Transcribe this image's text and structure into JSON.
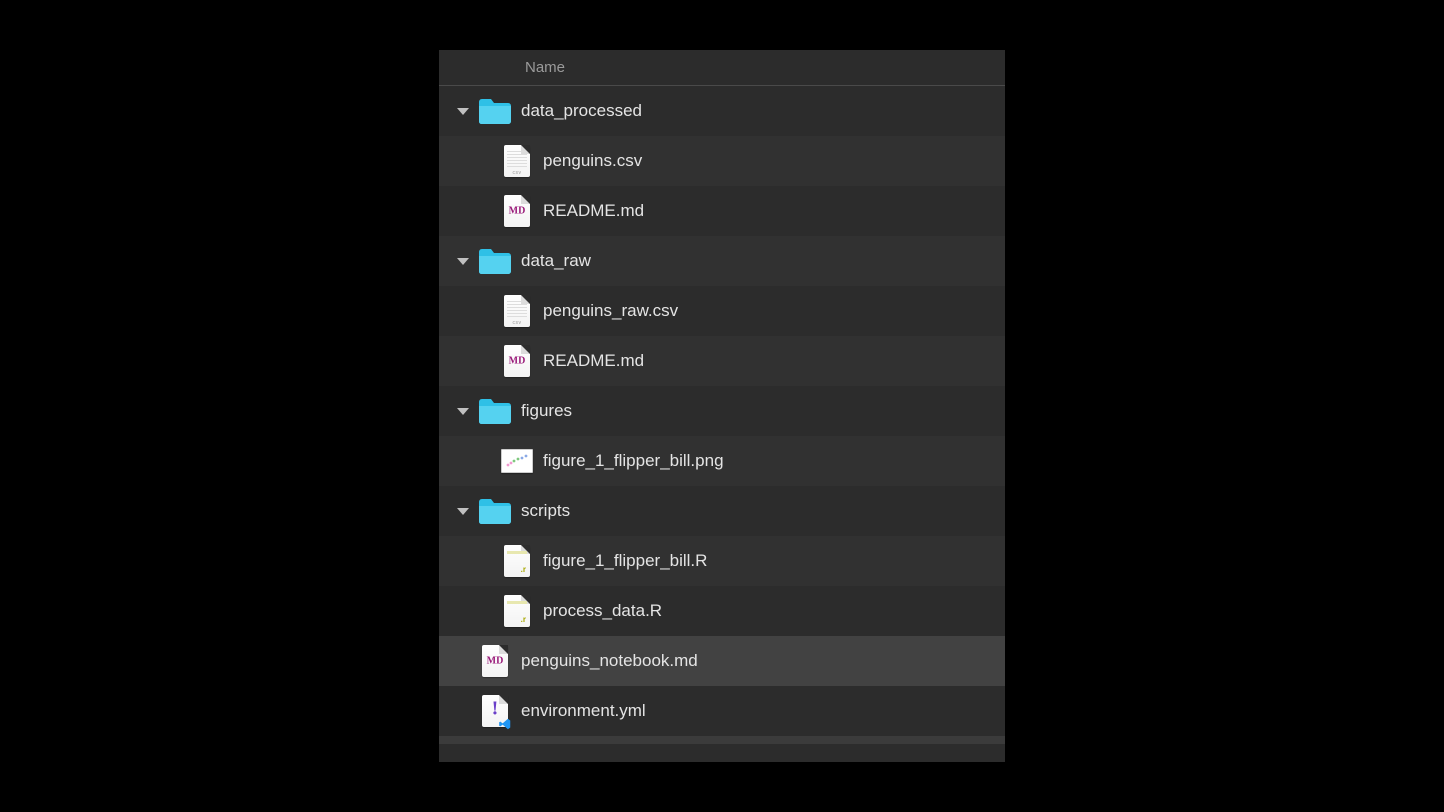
{
  "header": {
    "column_name": "Name"
  },
  "rows": [
    {
      "type": "folder",
      "name": "data_processed",
      "expanded": true,
      "depth": 0
    },
    {
      "type": "file",
      "name": "penguins.csv",
      "icon": "csv",
      "depth": 1
    },
    {
      "type": "file",
      "name": "README.md",
      "icon": "md",
      "depth": 1
    },
    {
      "type": "folder",
      "name": "data_raw",
      "expanded": true,
      "depth": 0
    },
    {
      "type": "file",
      "name": "penguins_raw.csv",
      "icon": "csv",
      "depth": 1
    },
    {
      "type": "file",
      "name": "README.md",
      "icon": "md",
      "depth": 1
    },
    {
      "type": "folder",
      "name": "figures",
      "expanded": true,
      "depth": 0
    },
    {
      "type": "file",
      "name": "figure_1_flipper_bill.png",
      "icon": "png",
      "depth": 1
    },
    {
      "type": "folder",
      "name": "scripts",
      "expanded": true,
      "depth": 0
    },
    {
      "type": "file",
      "name": "figure_1_flipper_bill.R",
      "icon": "r",
      "depth": 1
    },
    {
      "type": "file",
      "name": "process_data.R",
      "icon": "r",
      "depth": 1
    },
    {
      "type": "file",
      "name": "penguins_notebook.md",
      "icon": "md",
      "depth": 0,
      "selected": true
    },
    {
      "type": "file",
      "name": "environment.yml",
      "icon": "yml",
      "depth": 0
    }
  ]
}
